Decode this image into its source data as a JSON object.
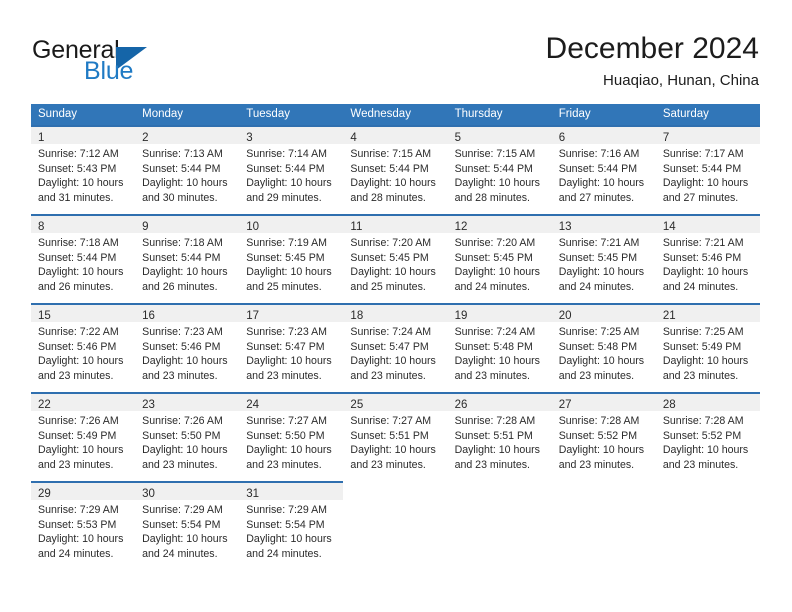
{
  "brand": {
    "name_part1": "General",
    "name_part2": "Blue",
    "logo_icon": "blue-triangle-icon"
  },
  "header": {
    "title": "December 2024",
    "location": "Huaqiao, Hunan, China"
  },
  "colors": {
    "header_blue": "#3176b8",
    "cell_top_border": "#2f6faf",
    "daynum_band": "#f0f0f0",
    "brand_blue": "#1f7ac4",
    "logo_triangle": "#1565a8",
    "text": "#2b2b2b"
  },
  "weekday_headers": [
    "Sunday",
    "Monday",
    "Tuesday",
    "Wednesday",
    "Thursday",
    "Friday",
    "Saturday"
  ],
  "labels": {
    "sunrise": "Sunrise:",
    "sunset": "Sunset:",
    "daylight": "Daylight:"
  },
  "weeks": [
    [
      {
        "day": "1",
        "sunrise": "Sunrise: 7:12 AM",
        "sunset": "Sunset: 5:43 PM",
        "daylight1": "Daylight: 10 hours",
        "daylight2": "and 31 minutes."
      },
      {
        "day": "2",
        "sunrise": "Sunrise: 7:13 AM",
        "sunset": "Sunset: 5:44 PM",
        "daylight1": "Daylight: 10 hours",
        "daylight2": "and 30 minutes."
      },
      {
        "day": "3",
        "sunrise": "Sunrise: 7:14 AM",
        "sunset": "Sunset: 5:44 PM",
        "daylight1": "Daylight: 10 hours",
        "daylight2": "and 29 minutes."
      },
      {
        "day": "4",
        "sunrise": "Sunrise: 7:15 AM",
        "sunset": "Sunset: 5:44 PM",
        "daylight1": "Daylight: 10 hours",
        "daylight2": "and 28 minutes."
      },
      {
        "day": "5",
        "sunrise": "Sunrise: 7:15 AM",
        "sunset": "Sunset: 5:44 PM",
        "daylight1": "Daylight: 10 hours",
        "daylight2": "and 28 minutes."
      },
      {
        "day": "6",
        "sunrise": "Sunrise: 7:16 AM",
        "sunset": "Sunset: 5:44 PM",
        "daylight1": "Daylight: 10 hours",
        "daylight2": "and 27 minutes."
      },
      {
        "day": "7",
        "sunrise": "Sunrise: 7:17 AM",
        "sunset": "Sunset: 5:44 PM",
        "daylight1": "Daylight: 10 hours",
        "daylight2": "and 27 minutes."
      }
    ],
    [
      {
        "day": "8",
        "sunrise": "Sunrise: 7:18 AM",
        "sunset": "Sunset: 5:44 PM",
        "daylight1": "Daylight: 10 hours",
        "daylight2": "and 26 minutes."
      },
      {
        "day": "9",
        "sunrise": "Sunrise: 7:18 AM",
        "sunset": "Sunset: 5:44 PM",
        "daylight1": "Daylight: 10 hours",
        "daylight2": "and 26 minutes."
      },
      {
        "day": "10",
        "sunrise": "Sunrise: 7:19 AM",
        "sunset": "Sunset: 5:45 PM",
        "daylight1": "Daylight: 10 hours",
        "daylight2": "and 25 minutes."
      },
      {
        "day": "11",
        "sunrise": "Sunrise: 7:20 AM",
        "sunset": "Sunset: 5:45 PM",
        "daylight1": "Daylight: 10 hours",
        "daylight2": "and 25 minutes."
      },
      {
        "day": "12",
        "sunrise": "Sunrise: 7:20 AM",
        "sunset": "Sunset: 5:45 PM",
        "daylight1": "Daylight: 10 hours",
        "daylight2": "and 24 minutes."
      },
      {
        "day": "13",
        "sunrise": "Sunrise: 7:21 AM",
        "sunset": "Sunset: 5:45 PM",
        "daylight1": "Daylight: 10 hours",
        "daylight2": "and 24 minutes."
      },
      {
        "day": "14",
        "sunrise": "Sunrise: 7:21 AM",
        "sunset": "Sunset: 5:46 PM",
        "daylight1": "Daylight: 10 hours",
        "daylight2": "and 24 minutes."
      }
    ],
    [
      {
        "day": "15",
        "sunrise": "Sunrise: 7:22 AM",
        "sunset": "Sunset: 5:46 PM",
        "daylight1": "Daylight: 10 hours",
        "daylight2": "and 23 minutes."
      },
      {
        "day": "16",
        "sunrise": "Sunrise: 7:23 AM",
        "sunset": "Sunset: 5:46 PM",
        "daylight1": "Daylight: 10 hours",
        "daylight2": "and 23 minutes."
      },
      {
        "day": "17",
        "sunrise": "Sunrise: 7:23 AM",
        "sunset": "Sunset: 5:47 PM",
        "daylight1": "Daylight: 10 hours",
        "daylight2": "and 23 minutes."
      },
      {
        "day": "18",
        "sunrise": "Sunrise: 7:24 AM",
        "sunset": "Sunset: 5:47 PM",
        "daylight1": "Daylight: 10 hours",
        "daylight2": "and 23 minutes."
      },
      {
        "day": "19",
        "sunrise": "Sunrise: 7:24 AM",
        "sunset": "Sunset: 5:48 PM",
        "daylight1": "Daylight: 10 hours",
        "daylight2": "and 23 minutes."
      },
      {
        "day": "20",
        "sunrise": "Sunrise: 7:25 AM",
        "sunset": "Sunset: 5:48 PM",
        "daylight1": "Daylight: 10 hours",
        "daylight2": "and 23 minutes."
      },
      {
        "day": "21",
        "sunrise": "Sunrise: 7:25 AM",
        "sunset": "Sunset: 5:49 PM",
        "daylight1": "Daylight: 10 hours",
        "daylight2": "and 23 minutes."
      }
    ],
    [
      {
        "day": "22",
        "sunrise": "Sunrise: 7:26 AM",
        "sunset": "Sunset: 5:49 PM",
        "daylight1": "Daylight: 10 hours",
        "daylight2": "and 23 minutes."
      },
      {
        "day": "23",
        "sunrise": "Sunrise: 7:26 AM",
        "sunset": "Sunset: 5:50 PM",
        "daylight1": "Daylight: 10 hours",
        "daylight2": "and 23 minutes."
      },
      {
        "day": "24",
        "sunrise": "Sunrise: 7:27 AM",
        "sunset": "Sunset: 5:50 PM",
        "daylight1": "Daylight: 10 hours",
        "daylight2": "and 23 minutes."
      },
      {
        "day": "25",
        "sunrise": "Sunrise: 7:27 AM",
        "sunset": "Sunset: 5:51 PM",
        "daylight1": "Daylight: 10 hours",
        "daylight2": "and 23 minutes."
      },
      {
        "day": "26",
        "sunrise": "Sunrise: 7:28 AM",
        "sunset": "Sunset: 5:51 PM",
        "daylight1": "Daylight: 10 hours",
        "daylight2": "and 23 minutes."
      },
      {
        "day": "27",
        "sunrise": "Sunrise: 7:28 AM",
        "sunset": "Sunset: 5:52 PM",
        "daylight1": "Daylight: 10 hours",
        "daylight2": "and 23 minutes."
      },
      {
        "day": "28",
        "sunrise": "Sunrise: 7:28 AM",
        "sunset": "Sunset: 5:52 PM",
        "daylight1": "Daylight: 10 hours",
        "daylight2": "and 23 minutes."
      }
    ],
    [
      {
        "day": "29",
        "sunrise": "Sunrise: 7:29 AM",
        "sunset": "Sunset: 5:53 PM",
        "daylight1": "Daylight: 10 hours",
        "daylight2": "and 24 minutes."
      },
      {
        "day": "30",
        "sunrise": "Sunrise: 7:29 AM",
        "sunset": "Sunset: 5:54 PM",
        "daylight1": "Daylight: 10 hours",
        "daylight2": "and 24 minutes."
      },
      {
        "day": "31",
        "sunrise": "Sunrise: 7:29 AM",
        "sunset": "Sunset: 5:54 PM",
        "daylight1": "Daylight: 10 hours",
        "daylight2": "and 24 minutes."
      },
      {
        "day": "",
        "sunrise": "",
        "sunset": "",
        "daylight1": "",
        "daylight2": "",
        "empty": true
      },
      {
        "day": "",
        "sunrise": "",
        "sunset": "",
        "daylight1": "",
        "daylight2": "",
        "empty": true
      },
      {
        "day": "",
        "sunrise": "",
        "sunset": "",
        "daylight1": "",
        "daylight2": "",
        "empty": true
      },
      {
        "day": "",
        "sunrise": "",
        "sunset": "",
        "daylight1": "",
        "daylight2": "",
        "empty": true
      }
    ]
  ]
}
